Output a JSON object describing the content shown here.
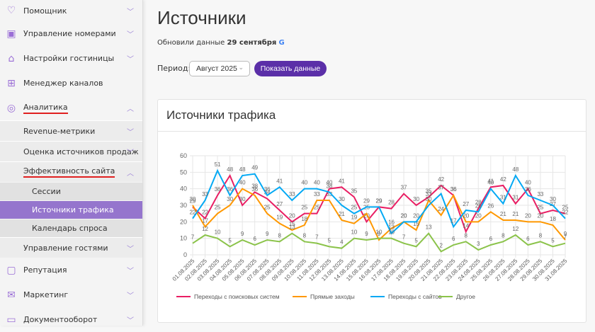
{
  "sidebar": {
    "items": [
      {
        "label": "Помощник",
        "icon": "heart-icon"
      },
      {
        "label": "Управление номерами",
        "icon": "calendar-icon"
      },
      {
        "label": "Настройки гостиницы",
        "icon": "house-icon"
      },
      {
        "label": "Менеджер каналов",
        "icon": "hierarchy-icon"
      },
      {
        "label": "Аналитика",
        "icon": "target-icon"
      },
      {
        "label": "Revenue-метрики"
      },
      {
        "label": "Оценка источников продаж"
      },
      {
        "label": "Эффективность сайта"
      },
      {
        "label": "Сессии"
      },
      {
        "label": "Источники трафика"
      },
      {
        "label": "Календарь спроса"
      },
      {
        "label": "Управление гостями"
      },
      {
        "label": "Репутация",
        "icon": "chat-icon"
      },
      {
        "label": "Маркетинг",
        "icon": "mail-icon"
      },
      {
        "label": "Документооборот",
        "icon": "folder-icon"
      }
    ]
  },
  "header": {
    "title": "Источники",
    "updated_prefix": "Обновили данные",
    "updated_date": "29 сентября",
    "period_label": "Период:",
    "period_value": "Август 2025",
    "show_button": "Показать данные"
  },
  "colors": {
    "accent": "#5b2fa8",
    "active": "#9575cd"
  },
  "chart_data": {
    "type": "line",
    "title": "Источники трафика",
    "ylim": [
      0,
      60
    ],
    "yticks": [
      0,
      10,
      20,
      30,
      40,
      50,
      60
    ],
    "grid": true,
    "legend_position": "bottom",
    "categories": [
      "01.08.2025",
      "02.08.2025",
      "03.08.2025",
      "04.08.2025",
      "05.08.2025",
      "06.08.2025",
      "07.08.2025",
      "08.08.2025",
      "09.08.2025",
      "10.08.2025",
      "11.08.2025",
      "12.08.2025",
      "13.08.2025",
      "14.08.2025",
      "15.08.2025",
      "16.08.2025",
      "17.08.2025",
      "18.08.2025",
      "19.08.2025",
      "20.08.2025",
      "21.08.2025",
      "22.08.2025",
      "23.08.2025",
      "24.08.2025",
      "25.08.2025",
      "26.08.2025",
      "27.08.2025",
      "28.08.2025",
      "29.08.2025",
      "30.08.2025",
      "31.08.2025"
    ],
    "series": [
      {
        "name": "Переходы с поисковых систем",
        "color": "#e91e63",
        "values": [
          29,
          22,
          36,
          48,
          30,
          38,
          34,
          27,
          20,
          25,
          25,
          40,
          41,
          35,
          20,
          29,
          28,
          37,
          30,
          35,
          42,
          36,
          14,
          28,
          41,
          42,
          31,
          40,
          25,
          27,
          25
        ]
      },
      {
        "name": "Прямые заходы",
        "color": "#ff9800",
        "values": [
          30,
          17,
          25,
          30,
          40,
          36,
          25,
          19,
          15,
          18,
          33,
          33,
          21,
          19,
          25,
          9,
          16,
          20,
          15,
          33,
          24,
          36,
          20,
          20,
          26,
          21,
          21,
          20,
          20,
          18,
          9
        ]
      },
      {
        "name": "Переходы с сайтов",
        "color": "#03a9f4",
        "values": [
          22,
          33,
          51,
          36,
          48,
          49,
          36,
          41,
          33,
          40,
          40,
          38,
          30,
          25,
          29,
          29,
          13,
          20,
          20,
          30,
          37,
          17,
          27,
          26,
          40,
          31,
          48,
          36,
          33,
          30,
          22
        ]
      },
      {
        "name": "Другое",
        "color": "#8bc34a",
        "values": [
          7,
          12,
          10,
          5,
          9,
          6,
          9,
          8,
          13,
          8,
          7,
          5,
          4,
          10,
          9,
          10,
          10,
          7,
          5,
          13,
          2,
          6,
          8,
          3,
          6,
          8,
          12,
          6,
          8,
          5,
          7
        ]
      }
    ]
  }
}
